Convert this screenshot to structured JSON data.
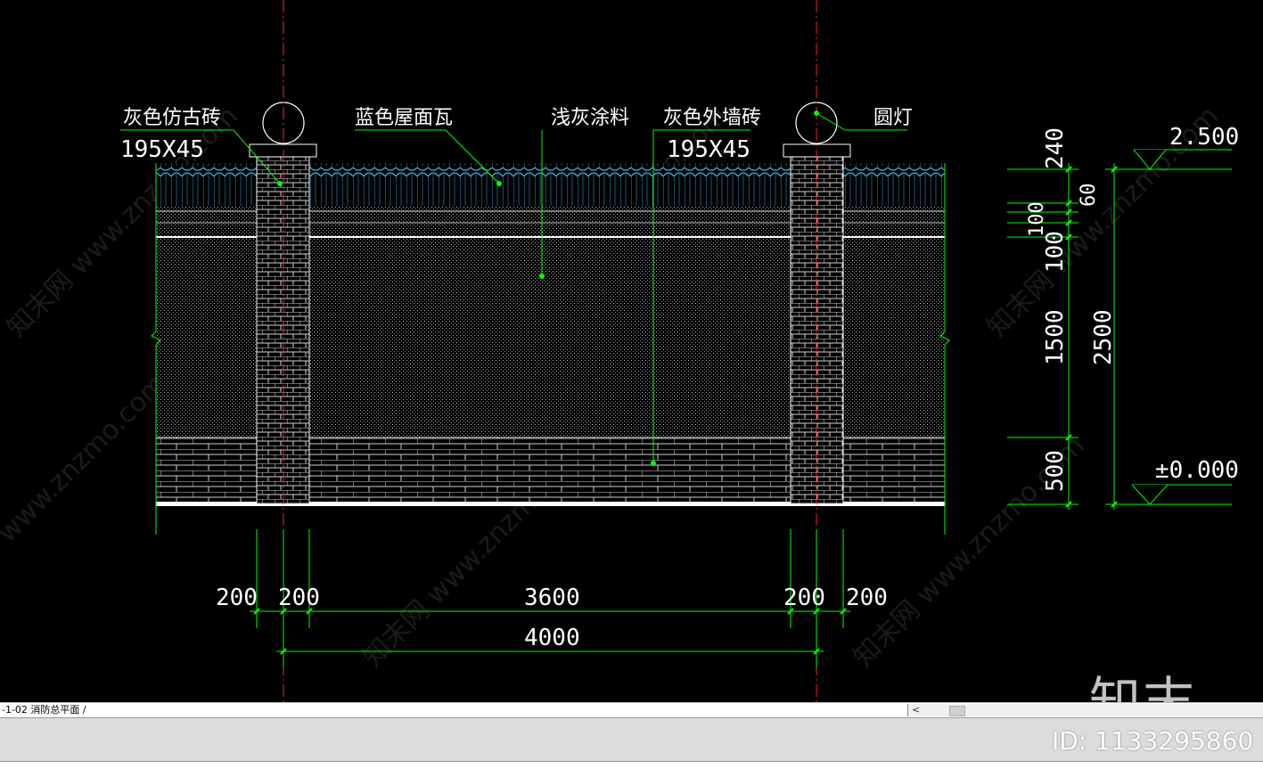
{
  "drawing": {
    "labels": {
      "tile_brick": "灰色仿古砖",
      "tile_brick_size": "195X45",
      "roof_tile": "蓝色屋面瓦",
      "coating": "浅灰涂料",
      "wall_brick": "灰色外墙砖",
      "wall_brick_size": "195X45",
      "lamp": "圆灯"
    },
    "levels": {
      "top": "2.500",
      "ground": "±0.000"
    },
    "vertical_dims": {
      "d240": "240",
      "d60": "60",
      "d100a": "100",
      "d100b": "100",
      "d1500": "1500",
      "d2500": "2500",
      "d500": "500"
    },
    "horizontal_dims": {
      "d200a": "200",
      "d200b": "200",
      "d3600": "3600",
      "d200c": "200",
      "d200d": "200",
      "d4000": "4000"
    },
    "colors": {
      "dim_line": "#00ff00",
      "leader": "#00ff00",
      "axis": "#ff0000",
      "hatch": "#ffffff",
      "roof": "#2aa7d6"
    }
  },
  "tab_bar": {
    "layout_tab": "-1-02  消防总平面 /",
    "scroll_left": "<"
  },
  "watermark": {
    "logo_text": "知末",
    "id_text": "ID: 1133295860",
    "site_text": "www.znzmo.com"
  }
}
